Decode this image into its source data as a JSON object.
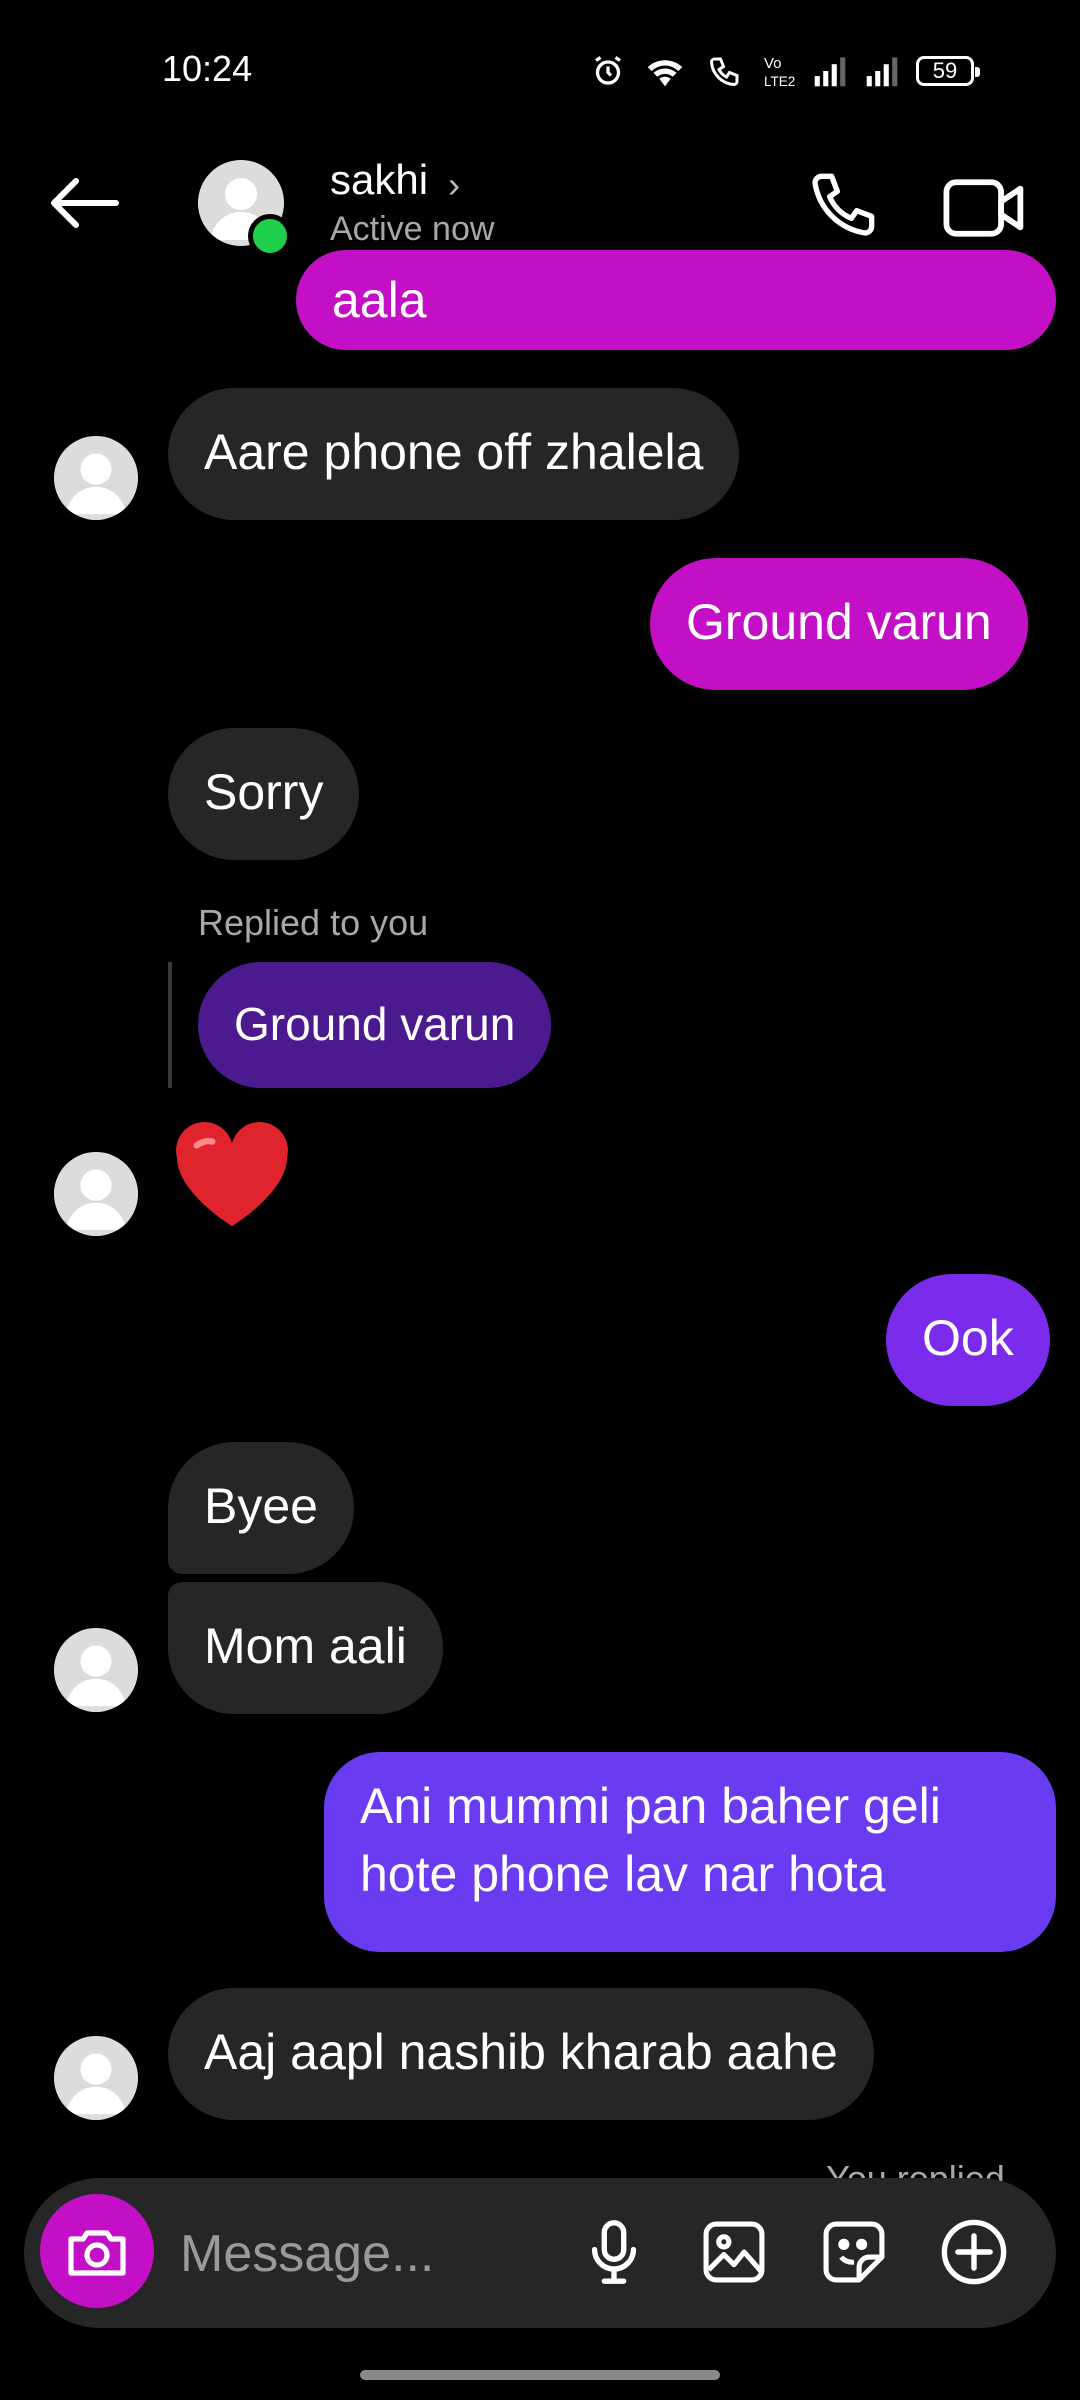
{
  "status_bar": {
    "time": "10:24",
    "battery": "59"
  },
  "header": {
    "name": "sakhi",
    "status": "Active now"
  },
  "messages": {
    "m0": "aala",
    "m1": "Aare phone off zhalela",
    "m2": "Ground varun",
    "m3": "Sorry",
    "reply_label": "Replied to you",
    "reply_quote": "Ground varun",
    "m4": "❤️",
    "m5": "Ook",
    "m6": "Byee",
    "m7": "Mom aali",
    "m8_line1": "Ani mummi pan baher geli",
    "m8_line2": "hote phone lav nar hota",
    "m9": "Aaj aapl nashib kharab aahe",
    "partial_hint": "You replied"
  },
  "composer": {
    "placeholder": "Message..."
  },
  "colors": {
    "sent_magenta": "#c30fc6",
    "sent_purple": "#7a2bec",
    "sent_violet": "#6a3cf1",
    "received": "#262626",
    "online": "#1fce4a"
  },
  "icons": [
    "back-arrow-icon",
    "chevron-right-icon",
    "phone-icon",
    "video-icon",
    "camera-icon",
    "microphone-icon",
    "gallery-icon",
    "sticker-icon",
    "plus-icon"
  ]
}
